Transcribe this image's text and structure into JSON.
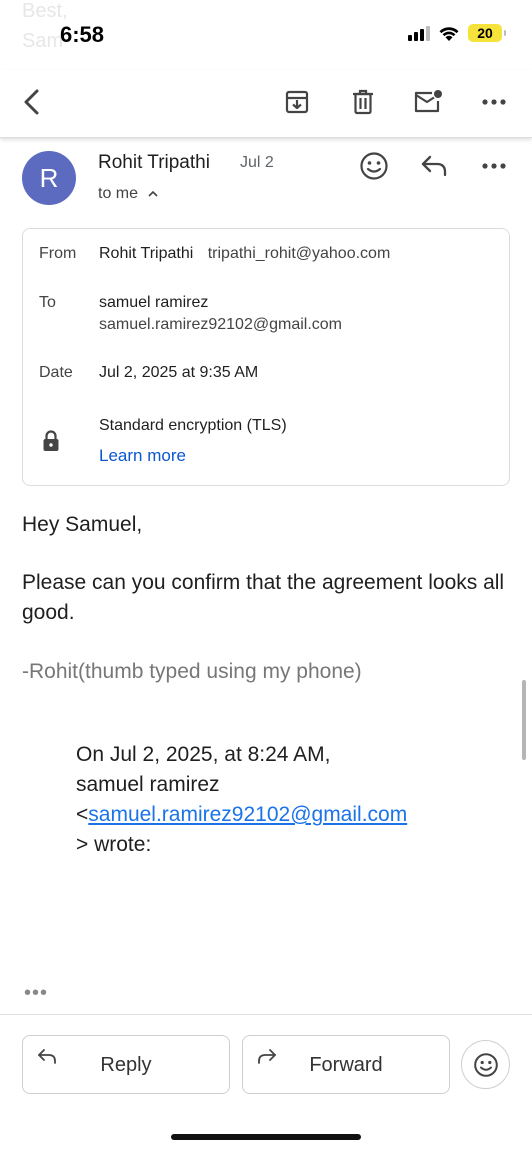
{
  "behind": {
    "line1": "Best,",
    "line2": "Sam"
  },
  "status": {
    "time": "6:58",
    "battery": "20"
  },
  "toolbar": {
    "back": "back-arrow-icon",
    "archive": "archive-icon",
    "delete": "trash-icon",
    "mark_unread": "mark-unread-icon",
    "more": "more-horizontal-icon"
  },
  "message": {
    "avatar_letter": "R",
    "sender": "Rohit Tripathi",
    "date": "Jul 2",
    "recipients": "to me",
    "details": {
      "from_label": "From",
      "from_name": "Rohit Tripathi",
      "from_email": "tripathi_rohit@yahoo.com",
      "to_label": "To",
      "to_name": "samuel ramirez",
      "to_email": "samuel.ramirez92102@gmail.com",
      "date_label": "Date",
      "date_value": "Jul 2, 2025 at 9:35 AM",
      "encryption": "Standard encryption (TLS)",
      "learn_more": "Learn more"
    },
    "body": {
      "greeting": "Hey Samuel,",
      "text": "Please can you confirm that the agreement looks all good.",
      "signature": "-Rohit(thumb typed using my phone)",
      "quote_line1": "On Jul 2, 2025, at 8:24 AM,",
      "quote_line2": "samuel ramirez",
      "quote_prefix": "<",
      "quote_email": "samuel.ramirez92102@gmail.com",
      "quote_line4": "> wrote:",
      "more": "•••"
    }
  },
  "footer": {
    "reply": "Reply",
    "forward": "Forward"
  },
  "colors": {
    "avatar": "#5c6bc0",
    "link": "#0b57d0",
    "battery": "#f5e33b"
  }
}
